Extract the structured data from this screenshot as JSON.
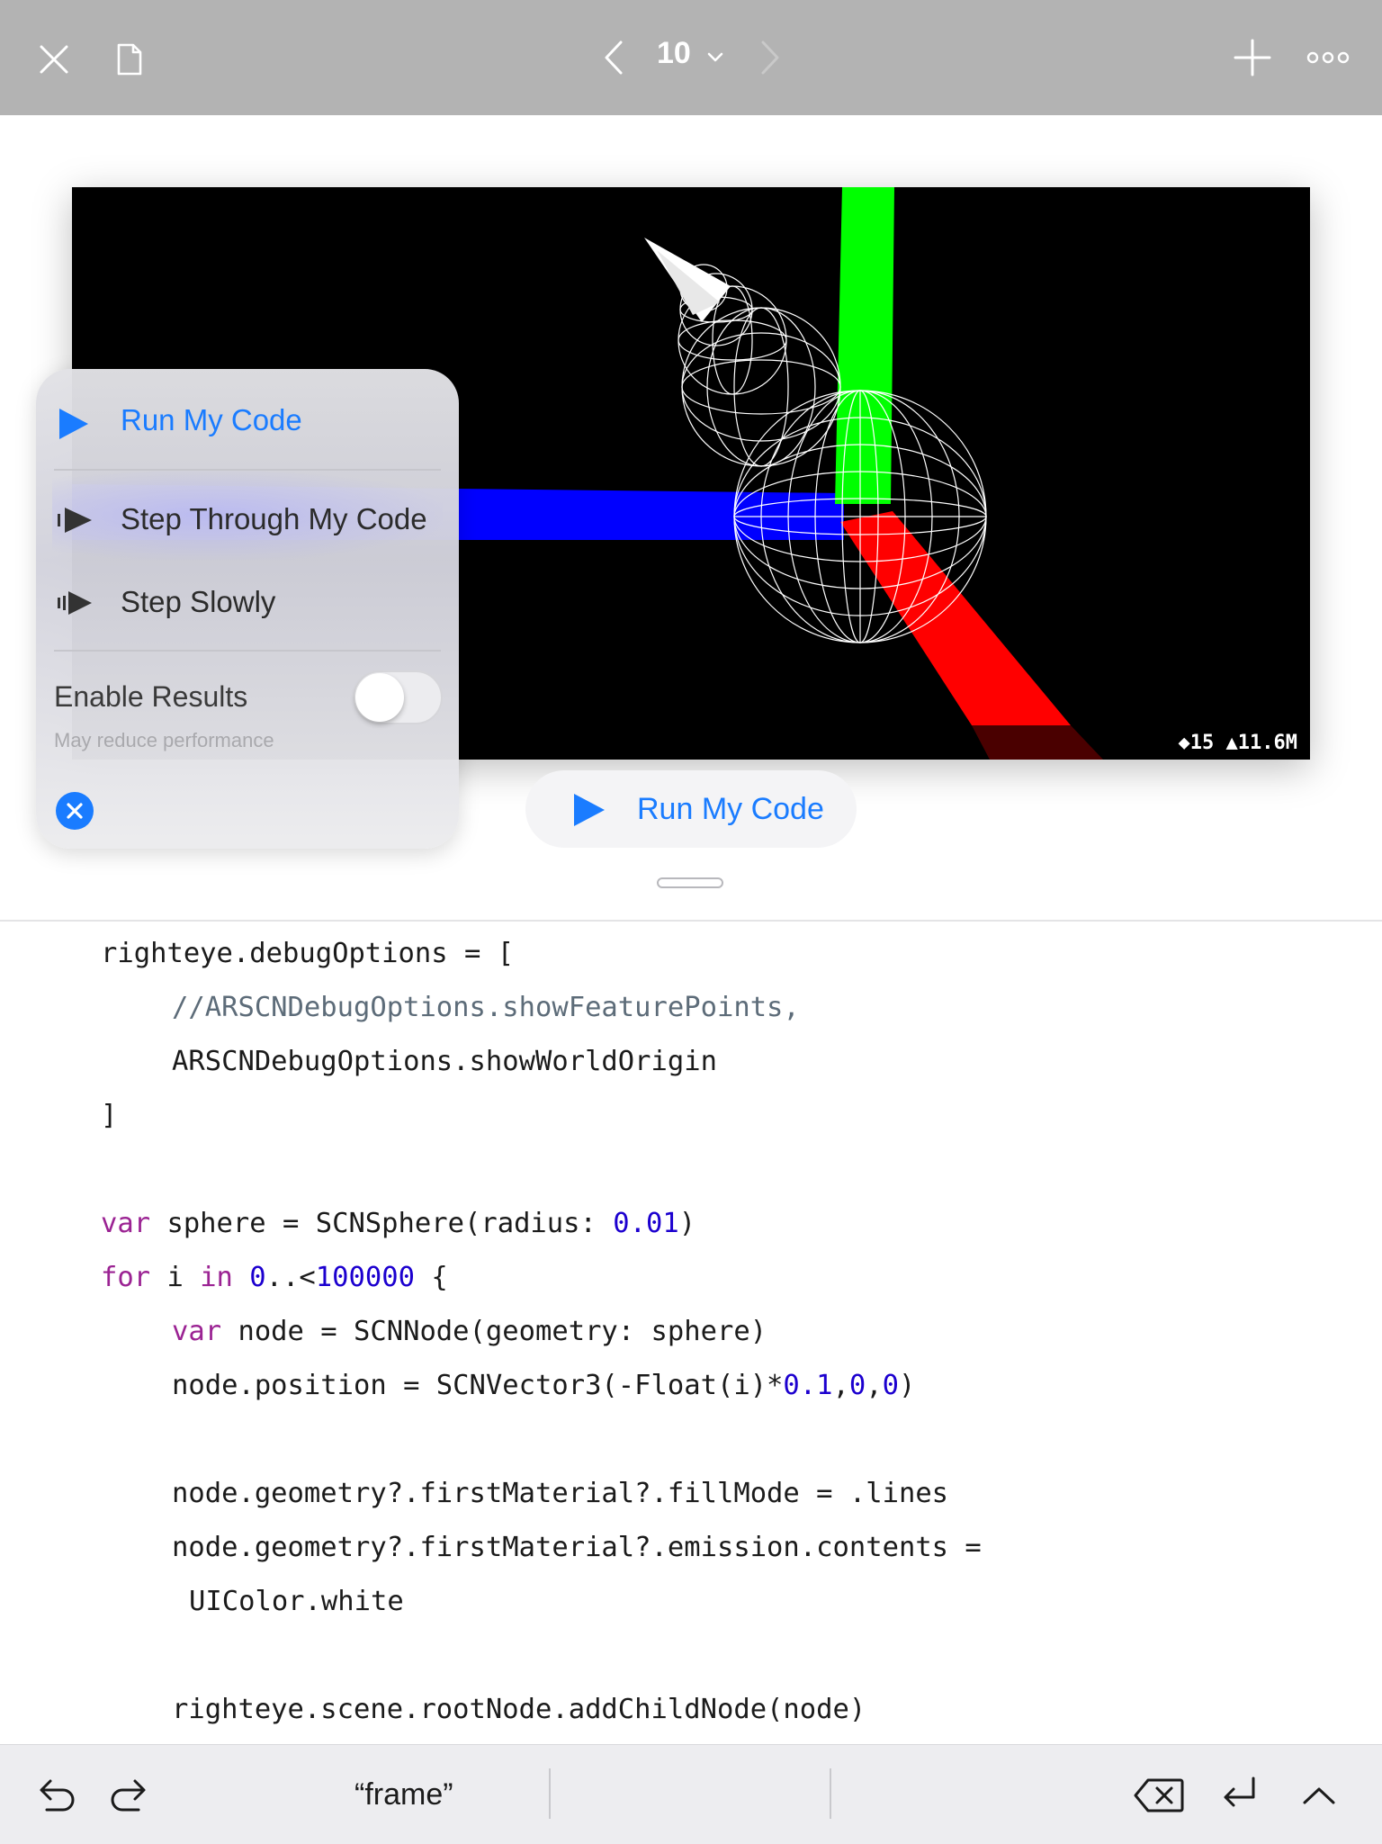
{
  "toolbar": {
    "page_number": "10",
    "icons": {
      "close": "close-icon",
      "document": "document-icon",
      "previous": "chevron-left-icon",
      "page_menu": "chevron-down-icon",
      "next": "chevron-right-icon",
      "add": "plus-icon",
      "more": "more-icon"
    }
  },
  "live_view": {
    "stats_nodes": "◆15",
    "stats_triangles": "▲11.6M",
    "colors": {
      "x_axis": "#ff0000",
      "y_axis": "#00ff00",
      "z_axis": "#0000ff",
      "wireframe": "#ffffff",
      "background": "#000000"
    }
  },
  "run_menu": {
    "run_my_code": "Run My Code",
    "step_through": "Step Through My Code",
    "step_slowly": "Step Slowly",
    "enable_results": "Enable Results",
    "enable_results_hint": "May reduce performance",
    "enable_results_on": false,
    "accent_color": "#1a7cff"
  },
  "run_button": {
    "label": "Run My Code"
  },
  "code": {
    "lines": [
      "righteye.debugOptions = [",
      "//ARSCNDebugOptions.showFeaturePoints,",
      "ARSCNDebugOptions.showWorldOrigin",
      "]",
      "",
      "var sphere = SCNSphere(radius: 0.01)",
      "for i in 0..<100000 {",
      "var node = SCNNode(geometry: sphere)",
      "node.position = SCNVector3(-Float(i)*0.1,0,0)",
      "",
      "node.geometry?.firstMaterial?.fillMode = .lines",
      "node.geometry?.firstMaterial?.emission.contents =",
      "UIColor.white",
      "",
      "righteye.scene.rootNode.addChildNode(node)"
    ],
    "tokens": {
      "var": "var",
      "for": "for",
      "in": "in",
      "sphere_decl": " sphere = SCNSphere(radius: ",
      "radius_val": "0.01",
      "close_paren": ")",
      "range_start": "0",
      "range_op": "..<",
      "range_end": "100000",
      "open_brace": " {",
      "node_decl": " node = SCNNode(geometry: sphere)",
      "pos_prefix": "node.position = SCNVector3(-Float(i)*",
      "pos_x": "0.1",
      "comma": ",",
      "pos_y": "0",
      "pos_z": "0"
    }
  },
  "shortcut_bar": {
    "suggestion": "“frame”",
    "icons": {
      "undo": "undo-icon",
      "redo": "redo-icon",
      "delete": "delete-backward-icon",
      "return": "return-icon",
      "hide_keyboard": "chevron-up-icon"
    }
  }
}
